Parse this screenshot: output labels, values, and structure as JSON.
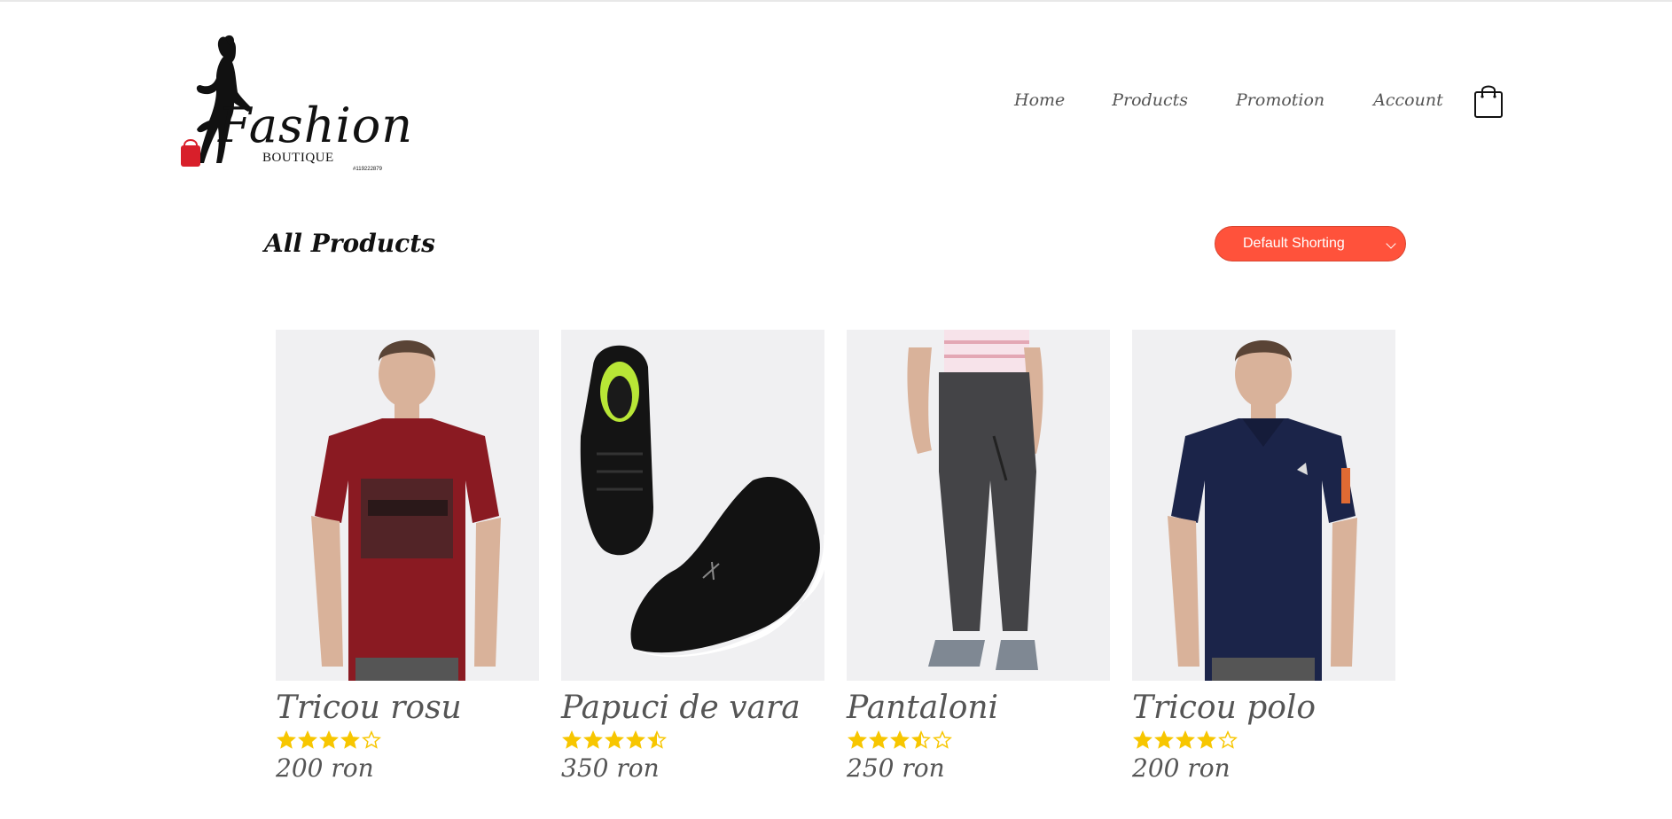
{
  "brand": {
    "logo_text": "Fashion",
    "logo_sub": "BOUTIQUE",
    "logo_small": "#119222879"
  },
  "nav": {
    "items": [
      "Home",
      "Products",
      "Promotion",
      "Account"
    ],
    "cart_icon": "shopping-bag-icon"
  },
  "main": {
    "title": "All Products",
    "sort": {
      "selected": "Default Shorting"
    }
  },
  "products": [
    {
      "name": "Tricou rosu",
      "rating": 4,
      "price": "200 ron",
      "shirt_color": "#8a1a22"
    },
    {
      "name": "Papuci de vara",
      "rating": 4.5,
      "price": "350 ron",
      "shirt_color": "#111111"
    },
    {
      "name": "Pantaloni",
      "rating": 3.5,
      "price": "250 ron",
      "shirt_color": "#444447"
    },
    {
      "name": "Tricou polo",
      "rating": 4,
      "price": "200 ron",
      "shirt_color": "#1b2449"
    }
  ],
  "colors": {
    "accent": "#ff523b",
    "star": "#f7c600",
    "text": "#555555"
  }
}
